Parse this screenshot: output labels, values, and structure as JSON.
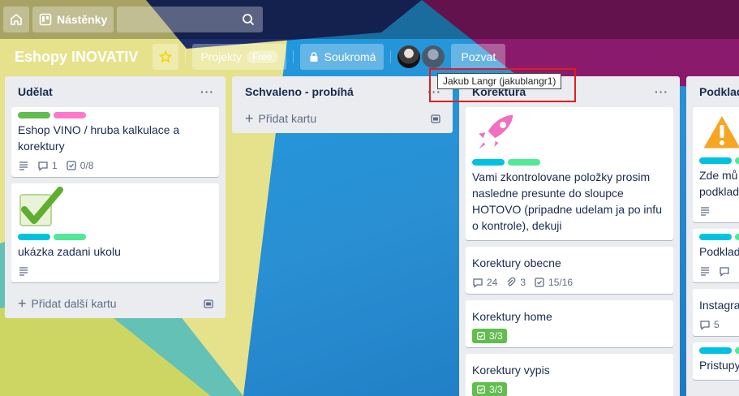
{
  "topbar": {
    "boards_label": "Nástěnky"
  },
  "board": {
    "title": "Eshopy INOVATIV",
    "workspace_label": "Projekty",
    "workspace_badge": "Free",
    "visibility_label": "Soukromá",
    "invite_label": "Pozvat"
  },
  "tooltip": {
    "text": "Jakub Langr (jakublangr1)"
  },
  "colors": {
    "label_green": "#61bd4f",
    "label_pink": "#ff78cb",
    "label_sky": "#00c2e0",
    "label_lime": "#51e898",
    "accent_red": "#e31c1c"
  },
  "lists": [
    {
      "title": "Udělat",
      "cards": [
        {
          "title": "Eshop VINO / hruba kalkulace a korektury",
          "comments": "1",
          "checklist": "0/8"
        },
        {
          "title": "ukázka zadani ukolu"
        }
      ],
      "add_label": "Přidat další kartu"
    },
    {
      "title": "Schvaleno - probíhá",
      "add_label": "Přidat kartu"
    },
    {
      "title": "Korektura",
      "cards": [
        {
          "title": "Vami zkontrolovane položky prosim nasledne presunte do sloupce HOTOVO (pripadne udelam ja po infu o kontrole), dekuji"
        },
        {
          "title": "Korektury obecne",
          "comments": "24",
          "attachments": "3",
          "checklist": "15/16"
        },
        {
          "title": "Korektury home",
          "checklist": "3/3"
        },
        {
          "title": "Korektury vypis",
          "checklist": "3/3"
        }
      ]
    },
    {
      "title": "Podklad",
      "cards": [
        {
          "title": "Zde mů podklad"
        },
        {
          "title": "Podklad"
        },
        {
          "title": "Instagra",
          "comments": "5"
        },
        {
          "title": "Pristupy"
        }
      ]
    }
  ]
}
